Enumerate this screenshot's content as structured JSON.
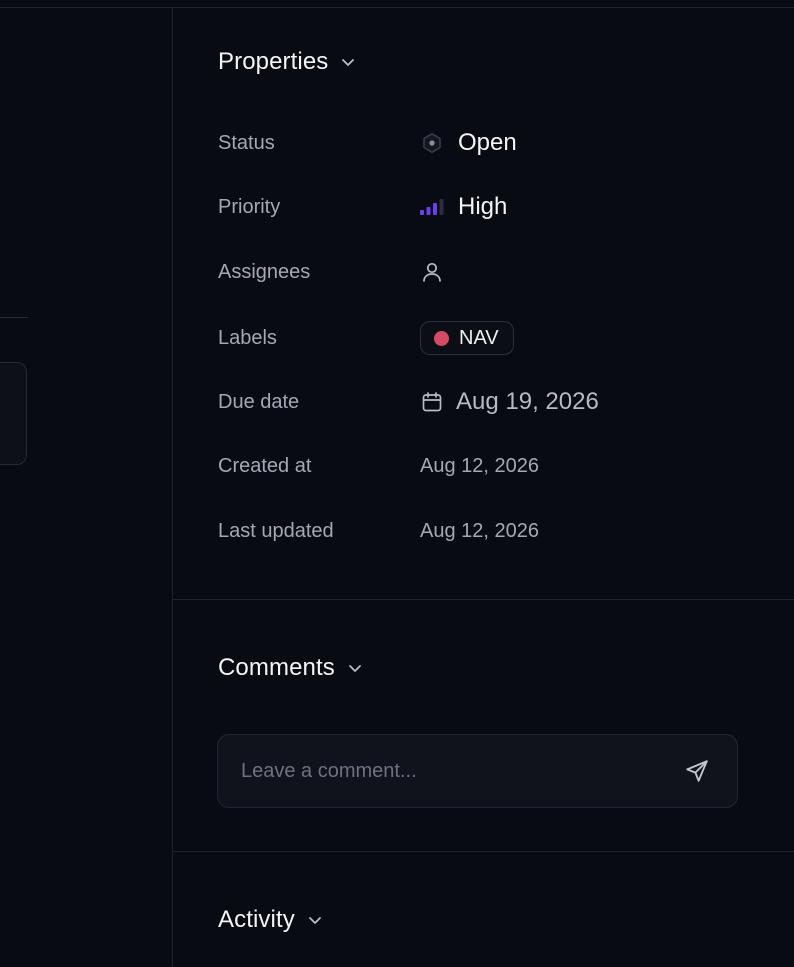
{
  "sections": {
    "properties": {
      "title": "Properties",
      "icon": "chevron-down-icon"
    },
    "comments": {
      "title": "Comments",
      "icon": "chevron-down-icon"
    },
    "activity": {
      "title": "Activity",
      "icon": "chevron-down-icon"
    }
  },
  "properties": {
    "status": {
      "label": "Status",
      "value": "Open",
      "icon": "hexagon-status-icon"
    },
    "priority": {
      "label": "Priority",
      "value": "High",
      "icon": "signal-bars-icon",
      "color": "#6d3ff0"
    },
    "assignees": {
      "label": "Assignees",
      "icon": "user-icon"
    },
    "labels": {
      "label": "Labels",
      "items": [
        {
          "name": "NAV",
          "color": "#d44b63"
        }
      ]
    },
    "due_date": {
      "label": "Due date",
      "value": "Aug 19, 2026",
      "icon": "calendar-icon"
    },
    "created_at": {
      "label": "Created at",
      "value": "Aug 12, 2026"
    },
    "last_updated": {
      "label": "Last updated",
      "value": "Aug 12, 2026"
    }
  },
  "comments": {
    "placeholder": "Leave a comment...",
    "send_icon": "send-icon"
  },
  "colors": {
    "background": "#090b12",
    "border": "#1f232e",
    "text_primary": "#f3f4f7",
    "text_secondary": "#a4a8b4",
    "priority_accent": "#6d3ff0",
    "label_nav": "#d44b63"
  }
}
